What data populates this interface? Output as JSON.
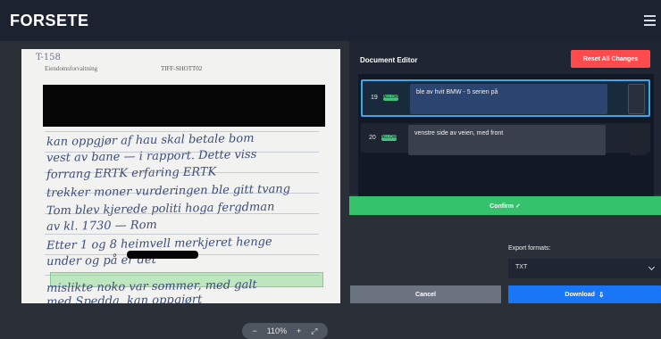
{
  "app": {
    "title": "FORSETE"
  },
  "viewer": {
    "document_heading_left": "Eiendomsforvaltning",
    "document_heading_right": "TIFF-SHOTT02",
    "document_tag": "T-158",
    "handwriting_lines": [
      "kan oppgjør af hau skal betale bom",
      "vest av bane — i rapport. Dette viss",
      "forrang ERTK erfaring ERTK",
      "trekker moner vurderingen ble gitt tvang",
      "Tom blev kjerede politi hoga fergdman",
      "av kl. 1730 — Rom",
      "Etter 1 og 8 heimvell merkjeret henge",
      "under og                på er det",
      "",
      "mislikte noko var sommer, med galt",
      "med Spedda. kan oppgjørt"
    ],
    "zoom": {
      "minus": "−",
      "value": "110%",
      "plus": "+",
      "fit": "⤢"
    }
  },
  "editor": {
    "title": "Document Editor",
    "reset_label": "Reset All Changes",
    "segments": [
      {
        "number": "19",
        "badge": "ALLOW",
        "text": "ble av hvit BMW - 5 serien på"
      },
      {
        "number": "20",
        "badge": "ALLOW",
        "text": "venstre side av veien, med front"
      }
    ]
  },
  "actions": {
    "confirm_label": "Confirm ✓",
    "export_label": "Export formats:",
    "export_value": "TXT",
    "cancel_label": "Cancel",
    "download_label": "Download"
  }
}
